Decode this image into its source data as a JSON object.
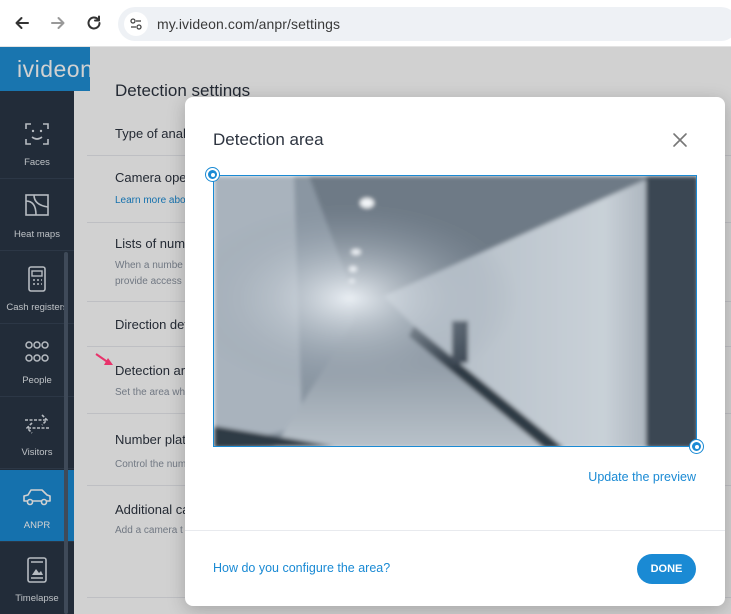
{
  "browser": {
    "back_icon": "back-arrow-icon",
    "forward_icon": "forward-arrow-icon",
    "reload_icon": "reload-icon",
    "url": "my.ivideon.com/anpr/settings"
  },
  "app": {
    "brand": "ivideon",
    "sidebar": [
      {
        "label": "Faces",
        "icon": "face-scan-icon"
      },
      {
        "label": "Heat maps",
        "icon": "heat-map-icon"
      },
      {
        "label": "Cash registers",
        "icon": "cash-register-icon"
      },
      {
        "label": "People",
        "icon": "people-icon"
      },
      {
        "label": "Visitors",
        "icon": "visitors-icon"
      },
      {
        "label": "ANPR",
        "icon": "car-icon",
        "active": true
      },
      {
        "label": "Timelapse",
        "icon": "timelapse-icon"
      }
    ]
  },
  "settings": {
    "title": "Detection settings",
    "rows": {
      "type": "Type of analy",
      "camera": "Camera oper",
      "learn": "Learn more abo",
      "lists": "Lists of num",
      "lists_desc_1": "When a numbe",
      "lists_desc_2": "provide access",
      "direction": "Direction det",
      "area": "Detection are",
      "area_desc": "Set the area wh",
      "plate": "Number plat",
      "plate_desc": "Control the num",
      "additional": "Additional ca",
      "additional_desc": "Add a camera t"
    }
  },
  "modal": {
    "title": "Detection area",
    "close_icon": "close-icon",
    "update_link": "Update the preview",
    "howto_link": "How do you configure the area?",
    "done_label": "DONE"
  },
  "colors": {
    "accent": "#1a8ad4",
    "sidebar": "#2a3646",
    "pointer": "#e8336b"
  }
}
